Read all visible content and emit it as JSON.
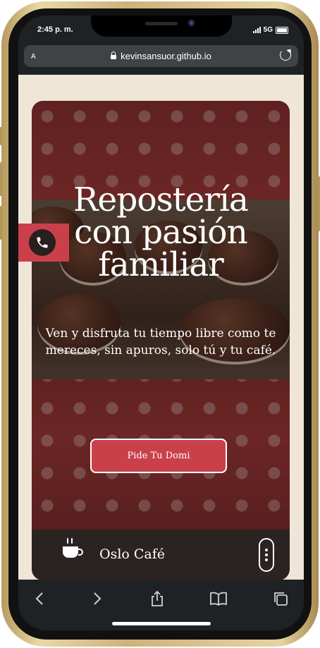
{
  "status_bar": {
    "time": "2:45 p. m.",
    "network": "5G"
  },
  "browser": {
    "text_size_label": "A",
    "url": "kevinsansuor.github.io"
  },
  "hero": {
    "title_lines": [
      "Repostería",
      "con pasión",
      "familiar"
    ],
    "subtitle": "Ven y disfruta tu tiempo libre como te mereces, sin apuros, solo tú y tu café.",
    "cta_label": "Pide Tu Domi"
  },
  "footer": {
    "brand_name": "Oslo Café"
  },
  "colors": {
    "accent": "#c9404a",
    "card_footer": "#2b2321",
    "page_bg": "#efe6d8",
    "browser_chrome": "#1f2224"
  },
  "icons": [
    "phone-icon",
    "coffee-cup-icon",
    "kebab-menu-icon",
    "lock-icon",
    "reload-icon",
    "back-icon",
    "forward-icon",
    "share-icon",
    "bookmarks-icon",
    "tabs-icon"
  ]
}
